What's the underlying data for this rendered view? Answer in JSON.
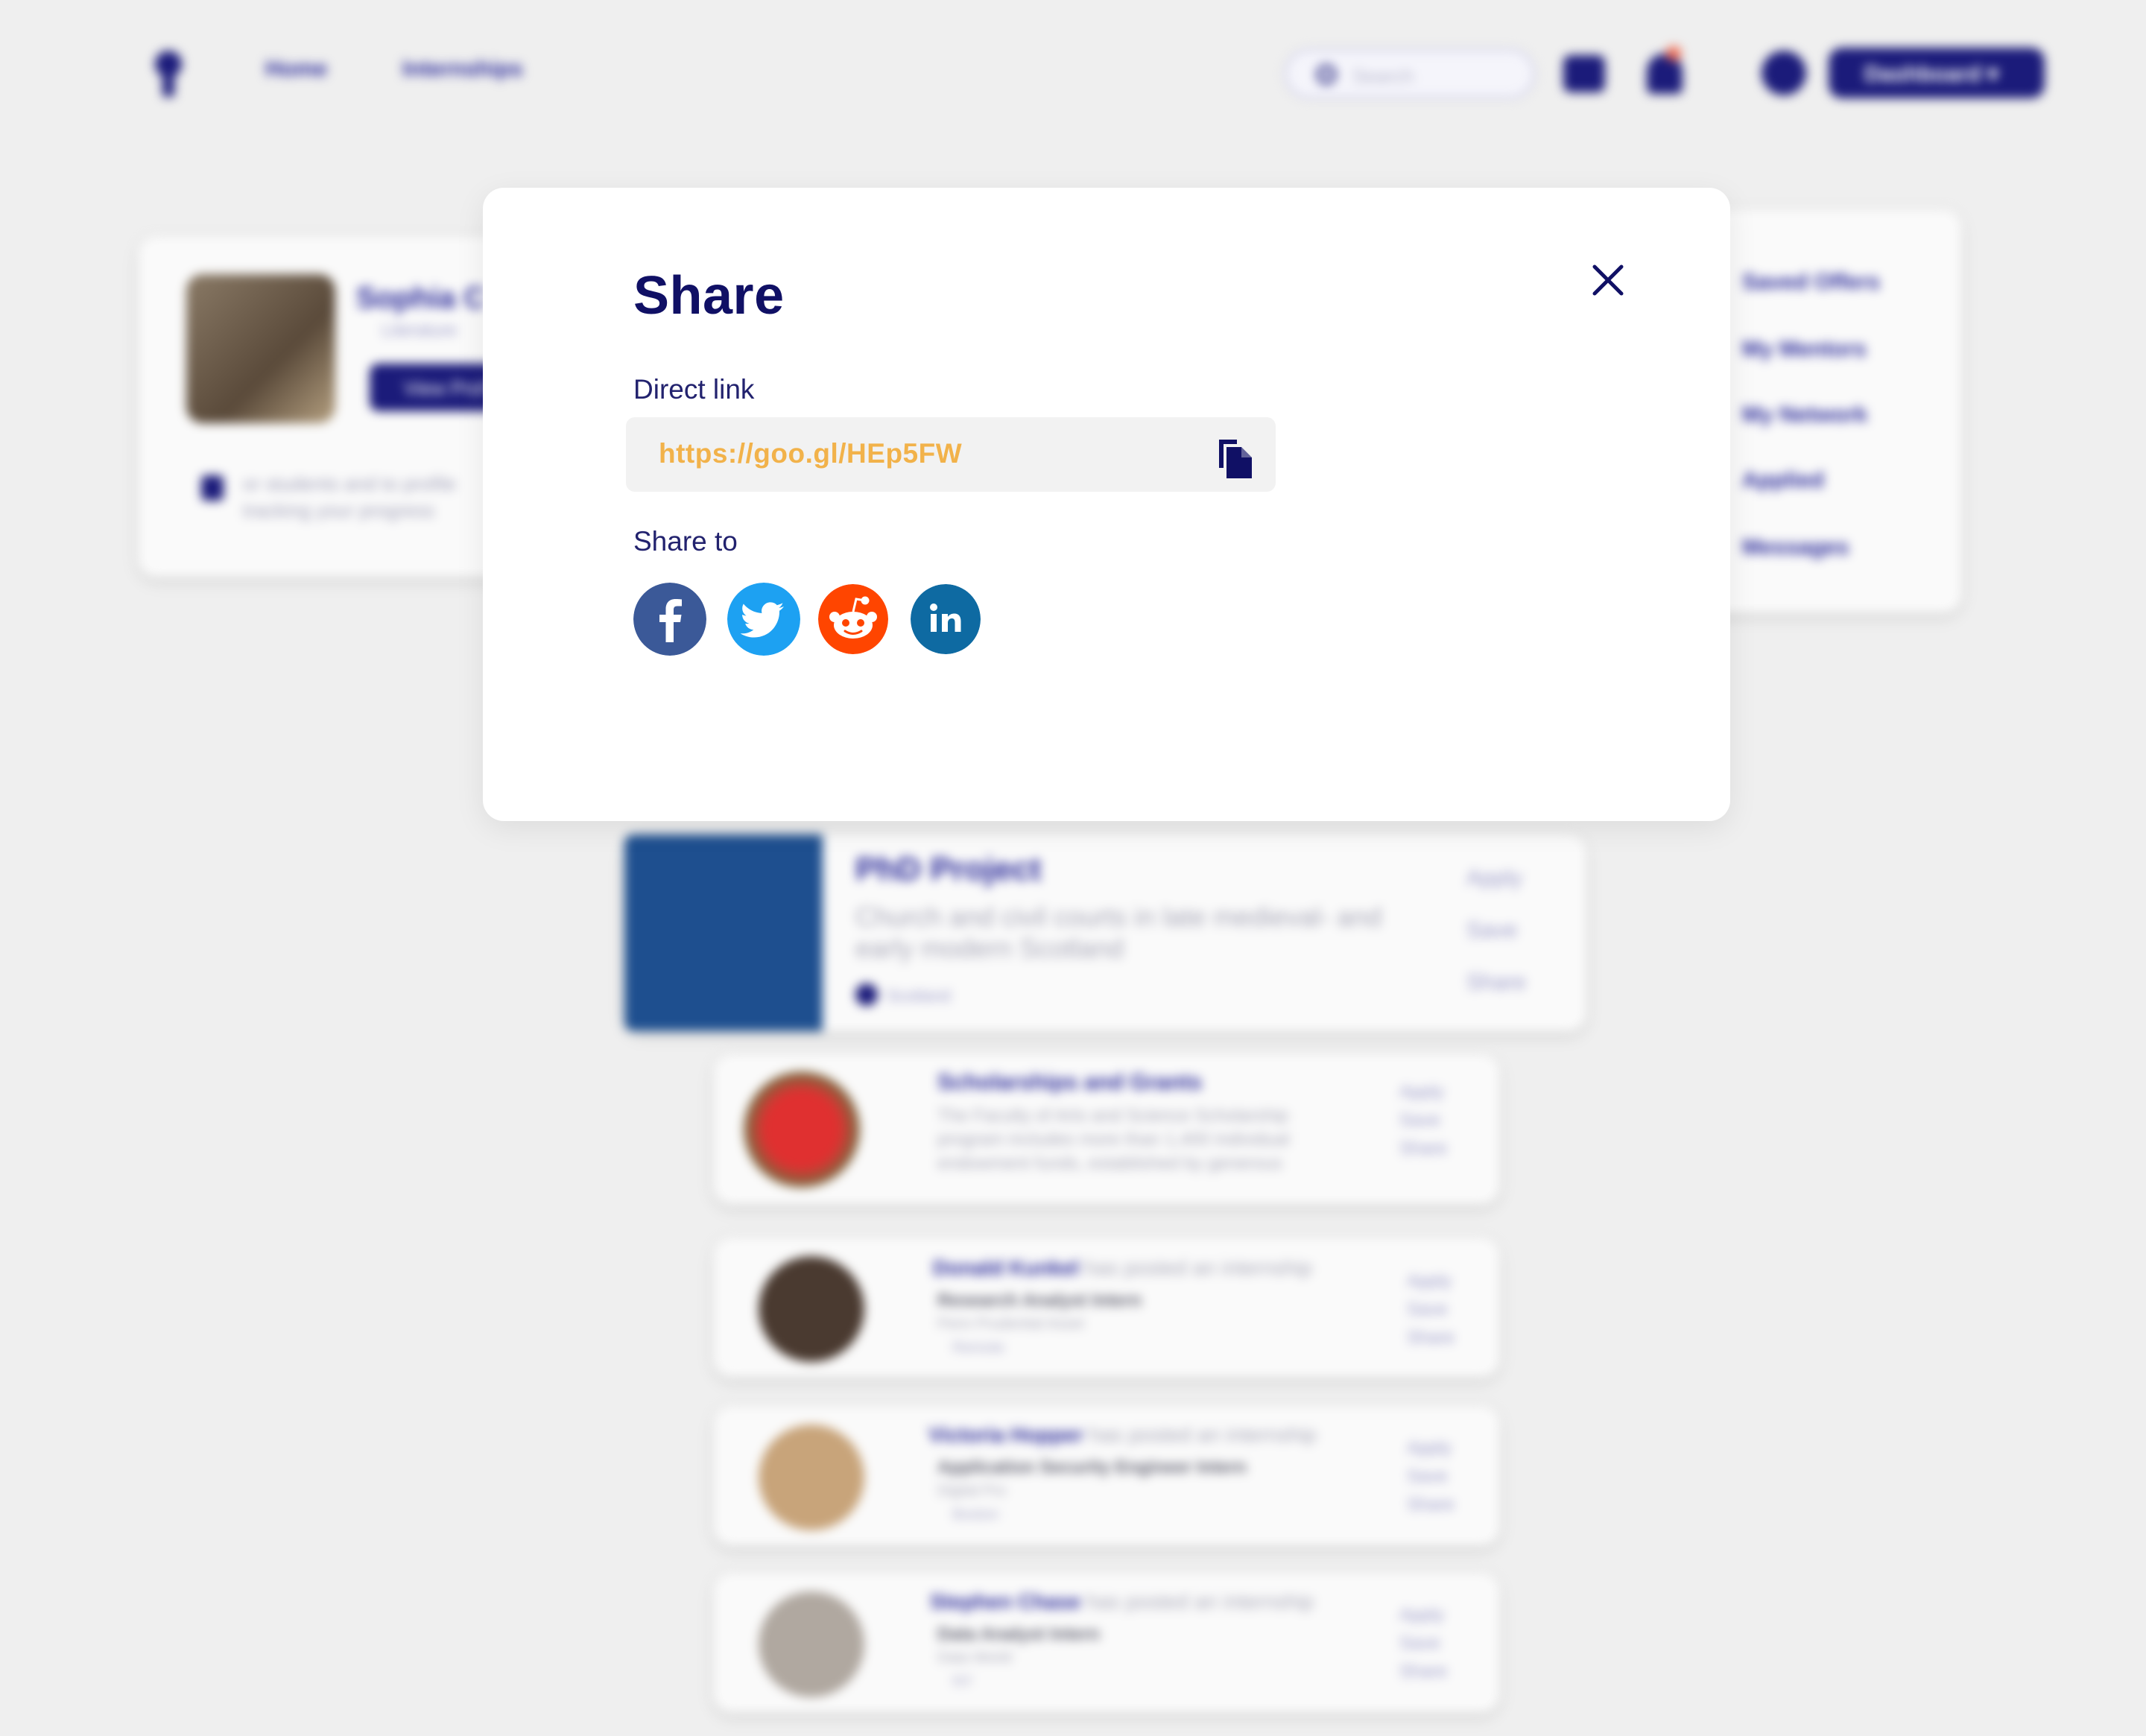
{
  "background": {
    "nav": {
      "home": "Home",
      "internships": "Internships",
      "search_placeholder": "Search",
      "dashboard": "Dashboard"
    },
    "profile": {
      "name": "Sophia C",
      "subtitle": "Literature",
      "button": "View Prof",
      "note_line1": "or students and to profile",
      "note_line2": "tracking your progress"
    },
    "side_menu": [
      "Saved Offers",
      "My Mentors",
      "My Network",
      "Applied",
      "Messages"
    ],
    "feature": {
      "title": "PhD Project",
      "line1": "Church and civil courts in late medieval- and",
      "line2": "early modern Scotland",
      "tag": "Scotland",
      "actions": [
        "Apply",
        "Save",
        "Share"
      ]
    },
    "feed": [
      {
        "title": "Scholarships and Grants",
        "line1": "The Faculty of Arts and Science Scholarship",
        "line2": "program includes more than 1,400 individual",
        "line3": "endowment funds, established by generous",
        "actions": [
          "Apply",
          "Save",
          "Share"
        ]
      },
      {
        "poster": "Donald Kunkel",
        "verb": "has posted an internship",
        "role": "Research Analyst Intern",
        "org": "Penn Prudential Asset",
        "loc": "Remote",
        "actions": [
          "Apply",
          "Save",
          "Share"
        ]
      },
      {
        "poster": "Victoria Hopper",
        "verb": "has posted an internship",
        "role": "Application Security Engineer Intern",
        "org": "Digital Pro",
        "loc": "Boston",
        "actions": [
          "Apply",
          "Save",
          "Share"
        ]
      },
      {
        "poster": "Stephen Chase",
        "verb": "has posted an internship",
        "role": "Data Analyst Intern",
        "org": "Data World",
        "loc": "NY",
        "actions": [
          "Apply",
          "Save",
          "Share"
        ]
      }
    ]
  },
  "modal": {
    "title": "Share",
    "direct_link_label": "Direct link",
    "link_url": "https://goo.gl/HEp5FW",
    "share_to_label": "Share to",
    "socials": [
      {
        "name": "facebook",
        "glyph": "f",
        "color": "#3b5998"
      },
      {
        "name": "twitter",
        "glyph": "",
        "color": "#1da1f2"
      },
      {
        "name": "reddit",
        "glyph": "",
        "color": "#ff4500"
      },
      {
        "name": "linkedin",
        "glyph": "in",
        "color": "#0e6aa2"
      }
    ],
    "accent_color": "#101065",
    "link_color": "#f2b24a"
  }
}
